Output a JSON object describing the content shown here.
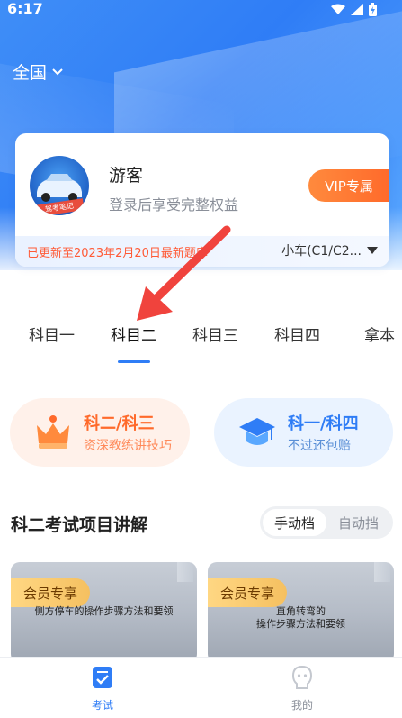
{
  "status_bar": {
    "time": "6:17"
  },
  "header": {
    "region": "全国"
  },
  "user_card": {
    "name": "游客",
    "subtitle": "登录后享受完整权益",
    "vip_button": "VIP专属",
    "avatar_banner": "驾考笔记",
    "update_text": "已更新至2023年2月20日最新题库",
    "car_type": "小车(C1/C2..."
  },
  "tabs": [
    {
      "label": "科目一"
    },
    {
      "label": "科目二"
    },
    {
      "label": "科目三"
    },
    {
      "label": "科目四"
    },
    {
      "label": "拿本"
    }
  ],
  "active_tab": "科目二",
  "promos": [
    {
      "title": "科二/科三",
      "subtitle": "资深教练讲技巧",
      "icon": "crown-icon"
    },
    {
      "title": "科一/科四",
      "subtitle": "不过还包赔",
      "icon": "graduation-cap-icon"
    }
  ],
  "section": {
    "title": "科二考试项目讲解",
    "toggle": [
      "手动档",
      "自动挡"
    ],
    "toggle_active": "手动档"
  },
  "videos": [
    {
      "badge": "会员专享",
      "caption_1": "侧方停车的操作步骤方法和要领",
      "caption_2": ""
    },
    {
      "badge": "会员专享",
      "caption_1": "直角转弯的",
      "caption_2": "操作步骤方法和要领"
    }
  ],
  "bottom_nav": [
    {
      "label": "考试",
      "icon": "exam-icon"
    },
    {
      "label": "我的",
      "icon": "profile-icon"
    }
  ],
  "colors": {
    "primary": "#2f7df6",
    "accent_orange": "#ff6a2b",
    "update_red": "#ff5a36"
  }
}
